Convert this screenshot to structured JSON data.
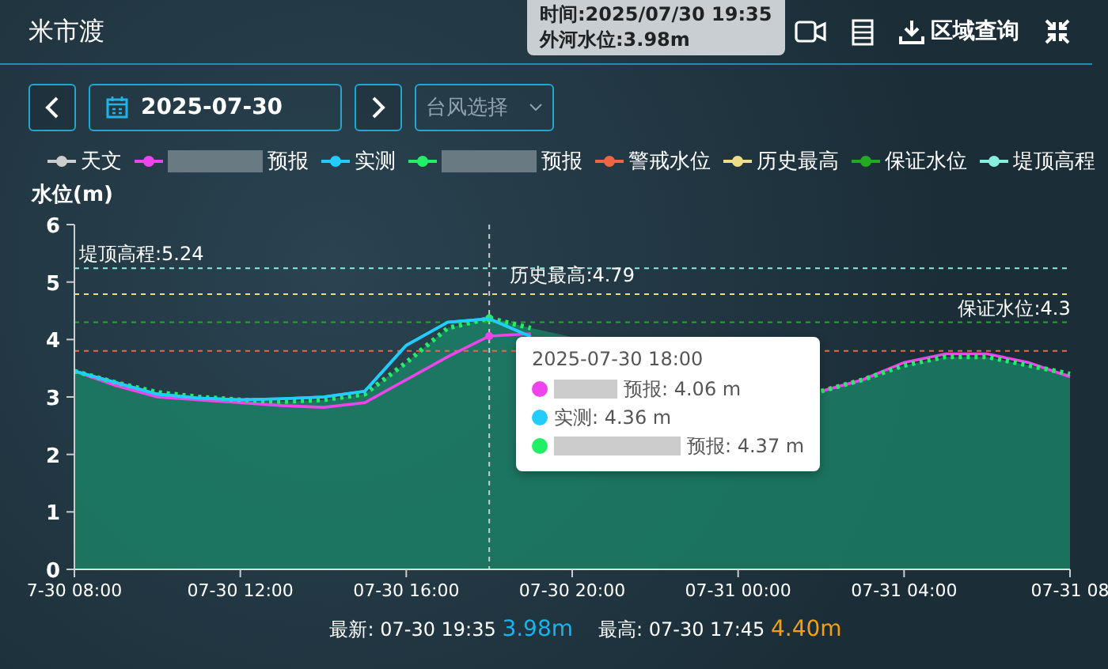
{
  "map_popup": {
    "lines": [
      "时间:2025/07/30 19:35",
      "外河水位:3.98m"
    ]
  },
  "header": {
    "title": "米市渡",
    "region_query": "区域查询"
  },
  "controls": {
    "date": "2025-07-30",
    "typhoon": {
      "placeholder": "台风选择"
    }
  },
  "legend": {
    "series_redacted": [
      false,
      true,
      false,
      true
    ],
    "extras": [
      {
        "name": "警戒水位",
        "color": "#ee6644"
      },
      {
        "name": "历史最高",
        "color": "#eedd88"
      },
      {
        "name": "保证水位",
        "color": "#22aa22"
      },
      {
        "name": "堤顶高程",
        "color": "#88eedd"
      }
    ]
  },
  "chart": {
    "chart_data": {
      "type": "line",
      "ylabel": "水位(m)",
      "categories": [
        "7-30 08:00",
        null,
        null,
        null,
        "07-30 12:00",
        null,
        null,
        null,
        "07-30 16:00",
        null,
        null,
        null,
        "07-30 20:00",
        null,
        null,
        null,
        "07-31 00:00",
        null,
        null,
        null,
        "07-31 04:00",
        null,
        null,
        null,
        "07-31 08"
      ],
      "ylim": [
        0,
        6
      ],
      "yticks": [
        0,
        1,
        2,
        3,
        4,
        5,
        6
      ],
      "series": [
        {
          "name": "天文",
          "color": "#cccccc",
          "values": [
            null,
            null,
            null,
            null,
            null,
            null,
            null,
            null,
            null,
            null,
            null,
            null,
            null,
            null,
            null,
            null,
            null,
            null,
            null,
            null,
            null,
            null,
            null,
            null,
            null
          ]
        },
        {
          "name": "预报",
          "color": "#ee44ee",
          "values": [
            3.45,
            3.2,
            3.0,
            2.95,
            2.9,
            2.85,
            2.82,
            2.9,
            3.3,
            3.7,
            4.06,
            4.1,
            null,
            null,
            null,
            null,
            null,
            null,
            3.1,
            3.3,
            3.6,
            3.75,
            3.75,
            3.6,
            3.35
          ]
        },
        {
          "name": "实测",
          "color": "#22ccff",
          "values": [
            3.45,
            3.25,
            3.05,
            2.98,
            2.95,
            2.97,
            3.0,
            3.1,
            3.9,
            4.3,
            4.36,
            4.05,
            null,
            null,
            null,
            null,
            null,
            null,
            null,
            null,
            null,
            null,
            null,
            null,
            null
          ]
        },
        {
          "name": "预报",
          "color": "#22ee66",
          "type": "area",
          "line_style": "dotted",
          "values": [
            3.45,
            3.25,
            3.08,
            3.0,
            2.95,
            2.92,
            2.95,
            3.05,
            3.6,
            4.2,
            4.37,
            4.2,
            null,
            null,
            null,
            null,
            null,
            null,
            3.1,
            3.3,
            3.55,
            3.7,
            3.7,
            3.55,
            3.4
          ]
        }
      ],
      "ref_lines": [
        {
          "axis": "y",
          "value": 3.8,
          "color": "#ee6644"
        },
        {
          "axis": "y",
          "value": 5.24,
          "label": "堤顶高程:5.24",
          "color": "#88eedd"
        },
        {
          "axis": "y",
          "value": 4.79,
          "label": "历史最高:4.79",
          "color": "#eedd88"
        },
        {
          "axis": "y",
          "value": 4.3,
          "label": "保证水位:4.3",
          "color": "#22aa22"
        }
      ]
    },
    "tooltip": {
      "title": "2025-07-30 18:00",
      "rows": [
        {
          "name": "预报: 4.06 m",
          "color": "#ee44ee",
          "redacted": true
        },
        {
          "name": "实测: 4.36 m",
          "color": "#22ccff",
          "redacted": false
        },
        {
          "name": "预报: 4.37 m",
          "color": "#22ee66",
          "redacted": true
        }
      ]
    }
  },
  "stats": {
    "latest_label": "最新:",
    "latest_time": "07-30 19:35",
    "latest_value": "3.98m",
    "max_label": "最高:",
    "max_time": "07-30 17:45",
    "max_value": "4.40m"
  }
}
